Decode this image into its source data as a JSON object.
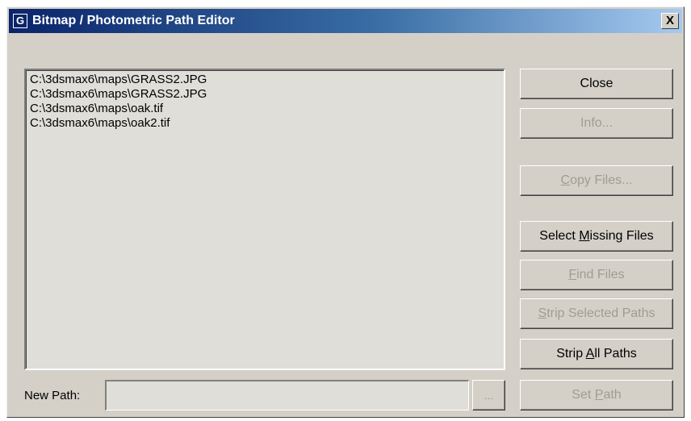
{
  "window": {
    "title": "Bitmap / Photometric Path Editor",
    "app_icon_glyph": "G",
    "close_glyph": "X"
  },
  "files": [
    "C:\\3dsmax6\\maps\\GRASS2.JPG",
    "C:\\3dsmax6\\maps\\GRASS2.JPG",
    "C:\\3dsmax6\\maps\\oak.tif",
    "C:\\3dsmax6\\maps\\oak2.tif"
  ],
  "buttons": {
    "close": {
      "label": "Close",
      "enabled": true
    },
    "info": {
      "label": "Info...",
      "enabled": false
    },
    "copy_files": {
      "pre": "",
      "accel": "C",
      "post": "opy Files...",
      "enabled": false
    },
    "select_missing": {
      "pre": "Select ",
      "accel": "M",
      "post": "issing Files",
      "enabled": true
    },
    "find_files": {
      "pre": "",
      "accel": "F",
      "post": "ind Files",
      "enabled": false
    },
    "strip_selected": {
      "pre": "",
      "accel": "S",
      "post": "trip Selected Paths",
      "enabled": false
    },
    "strip_all": {
      "pre": "Strip ",
      "accel": "A",
      "post": "ll Paths",
      "enabled": true
    },
    "set_path": {
      "pre": "Set ",
      "accel": "P",
      "post": "ath",
      "enabled": false
    }
  },
  "new_path": {
    "label": "New Path:",
    "value": "",
    "placeholder": "",
    "browse_label": "..."
  },
  "colors": {
    "titlebar_start": "#0a246a",
    "titlebar_end": "#a6caf0",
    "face": "#d4d0c8",
    "disabled_text": "#a09c94"
  },
  "icons": {
    "app": "gmax-app-icon",
    "close": "close-icon"
  }
}
